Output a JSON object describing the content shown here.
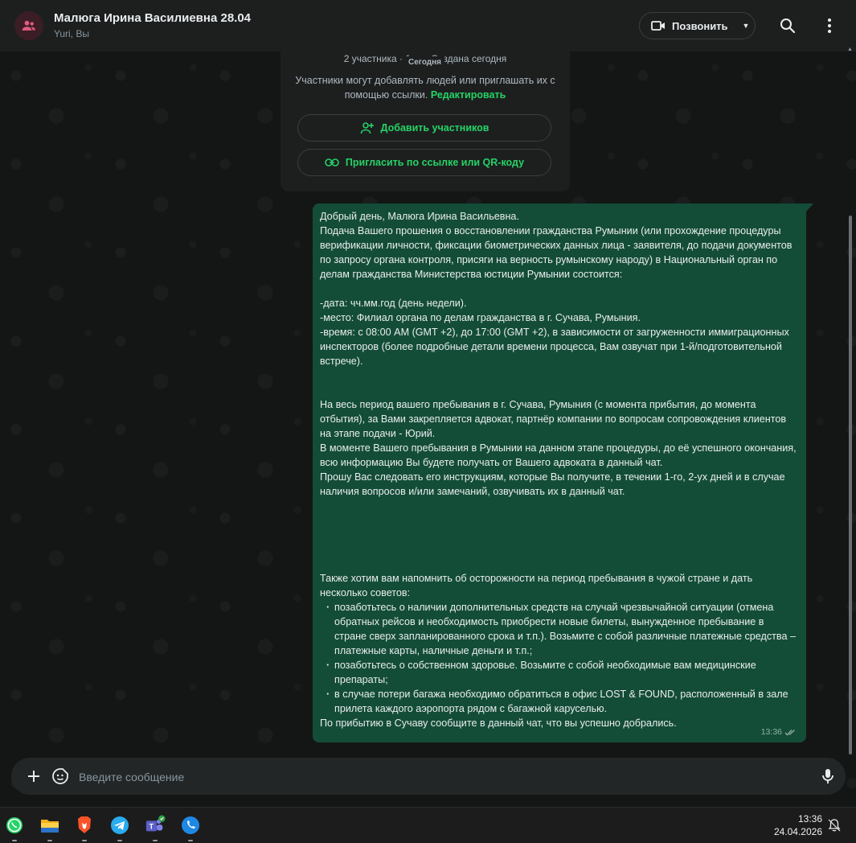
{
  "header": {
    "title": "Малюга Ирина Василиевна 28.04",
    "subtitle": "Yuri, Вы",
    "call_label": "Позвонить"
  },
  "info": {
    "meta": "2 участника · 1 п… Создана сегодня",
    "date_label": "Сегодня",
    "text": "Участники могут добавлять людей или приглашать их с помощью ссылки.",
    "edit_link": "Редактировать",
    "add_participants": "Добавить участников",
    "invite_link": "Пригласить по ссылке или QR-коду"
  },
  "message": {
    "p1": "Добрый день, Малюга Ирина Васильевна.",
    "p2": "Подача Вашего прошения о восстановлении гражданства Румынии (или прохождение процедуры верификации личности, фиксации биометрических данных лица - заявителя, до подачи документов по запросу органа контроля, присяги на верность румынскому народу) в Национальный орган по делам гражданства Министерства юстиции Румынии состоится:",
    "p3": "-дата: чч.мм.год (день недели).",
    "p4": "-место: Филиал органа по делам гражданства в г. Сучава, Румыния.",
    "p5": "-время: с 08:00 AM (GMT +2), до 17:00 (GMT +2), в зависимости от загруженности иммиграционных инспекторов (более подробные детали времени процесса, Вам озвучат при 1-й/подготовительной встрече).",
    "p6": "На весь период вашего пребывания в г. Сучава, Румыния (с момента прибытия, до момента отбытия), за Вами закрепляется адвокат, партнёр компании по вопросам сопровождения клиентов на этапе подачи - Юрий.",
    "p7": "В моменте Вашего пребывания в Румынии на данном этапе процедуры, до её успешного окончания, всю информацию Вы будете получать от Вашего адвоката в данный чат.",
    "p8": "Прошу Вас следовать его инструкциям, которые Вы получите, в течении 1-го, 2-ух дней и в случае наличия вопросов и/или замечаний, озвучивать их в данный чат.",
    "p9": "Также хотим вам напомнить об осторожности на период пребывания в чужой стране и дать несколько советов:",
    "bullets": [
      "позаботьтесь о наличии дополнительных средств на случай чрезвычайной ситуации (отмена обратных рейсов и необходимость приобрести новые билеты, вынужденное пребывание в стране сверх запланированного срока и т.п.). Возьмите с собой различные платежные средства – платежные карты, наличные деньги и т.п.;",
      "позаботьтесь о собственном здоровье. Возьмите с собой необходимые вам медицинские препараты;",
      "в случае потери багажа необходимо обратиться в офис LOST & FOUND, расположенный в зале прилета каждого аэропорта рядом с багажной каруселью."
    ],
    "p10": "По прибытию в Сучаву сообщите в данный чат, что вы успешно добрались.",
    "time": "13:36",
    "status": "read"
  },
  "composer": {
    "placeholder": "Введите сообщение"
  },
  "taskbar": {
    "apps": [
      "whatsapp-icon",
      "file-explorer-icon",
      "brave-icon",
      "telegram-icon",
      "teams-icon",
      "phone-icon"
    ],
    "time": "13:36",
    "date": "24.04.2026"
  },
  "colors": {
    "accent": "#25d366",
    "bubble": "#144d37",
    "background": "#121414"
  }
}
